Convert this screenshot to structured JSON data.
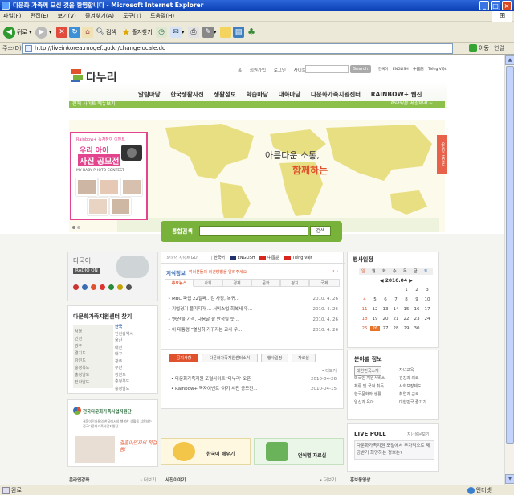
{
  "window": {
    "title": "다문화 가족께 오신 것을 환영합니다 - Microsoft Internet Explorer"
  },
  "menu": [
    "파일(F)",
    "편집(E)",
    "보기(V)",
    "즐겨찾기(A)",
    "도구(T)",
    "도움말(H)"
  ],
  "toolbar": {
    "back": "뒤로",
    "search": "검색",
    "favorites": "즐겨찾기"
  },
  "address": {
    "label": "주소(D)",
    "url": "http://liveinkorea.mogef.go.kr/changelocale.do",
    "go": "이동",
    "links": "연결"
  },
  "site": {
    "logo": "다누리",
    "top_links": [
      "홈",
      "회원가입",
      "로그인",
      "사이트맵"
    ],
    "search_button": "Search",
    "languages": [
      "한국어",
      "ENGLISH",
      "中國語",
      "Tiếng Việt"
    ],
    "shop_link": "전체 사이트 메뉴보기",
    "nav": [
      "알림마당",
      "한국생활사전",
      "생활정보",
      "학습마당",
      "대화마당",
      "다문화가족지원센터",
      "RAINBOW+ 웹진"
    ],
    "slogan": "하나되는 세상에서 ~",
    "quick_menu": "QUICK MENU"
  },
  "hero": {
    "line1": "아름다운 소통,",
    "line2": "함께하는"
  },
  "promo": {
    "top": "Rainbow+ 독자참여 이벤트",
    "line1": "우리 아이",
    "line2": "사진 공모전",
    "sub": "MY BABY PHOTO CONTEST"
  },
  "search": {
    "label": "통합검색",
    "button": "검색"
  },
  "radio": {
    "title": "다국어",
    "badge": "RADIO ON"
  },
  "center": {
    "title": "다문화가족지원센터 찾기",
    "regions": [
      "한국",
      "인천광역시",
      "울산",
      "대전",
      "대구",
      "광주",
      "부산",
      "강원도",
      "충청북도",
      "충청남도",
      "전라북도",
      "경상북도",
      "경상남도",
      "제주도"
    ],
    "regions_left": [
      "서울",
      "인천",
      "광주",
      "경기도",
      "강원도",
      "충청북도",
      "충청남도",
      "전라남도"
    ]
  },
  "notice": {
    "lang_title": "외국어 사이트 GO",
    "lang_items": [
      "한국어",
      "ENGLISH",
      "中國語",
      "Tiếng Việt"
    ],
    "knowledge_title": "지식정보",
    "knowledge_sub": "여러분들의 의견방법을 알려주세요",
    "tabs": [
      "주요뉴스",
      "사회",
      "경제",
      "문화",
      "정치",
      "국제"
    ],
    "items": [
      {
        "title": "MBC 파업 22일째...김 사장, 복귀...",
        "date": "2010. 4. 26"
      },
      {
        "title": "기업경기 불기지가 ... 서비스업 회복세 뚜...",
        "date": "2010. 4. 26"
      },
      {
        "title": "'농산물 가격, 다음달 할 안정될 듯...",
        "date": "2010. 4. 26"
      },
      {
        "title": "이 대통령 \"열심히 가꾸지는 교사 우...",
        "date": "2010. 4. 26"
      }
    ]
  },
  "calendar": {
    "title": "행사일정",
    "weekdays": [
      "일",
      "월",
      "화",
      "수",
      "목",
      "금",
      "토"
    ],
    "month": "◀ 2010.04 ▶",
    "rows": [
      [
        "",
        "",
        "",
        "",
        "1",
        "2",
        "3"
      ],
      [
        "4",
        "5",
        "6",
        "7",
        "8",
        "9",
        "10"
      ],
      [
        "11",
        "12",
        "13",
        "14",
        "15",
        "16",
        "17"
      ],
      [
        "18",
        "19",
        "20",
        "21",
        "22",
        "23",
        "24"
      ],
      [
        "25",
        "26",
        "27",
        "28",
        "29",
        "30",
        ""
      ]
    ],
    "today": "26"
  },
  "field": {
    "title": "분야별 정보",
    "rows": [
      [
        "대한민국소개",
        "자녀교육"
      ],
      [
        "외국인 지원서비스",
        "건강과 의료"
      ],
      [
        "체류 및 국적 취득",
        "사회보장제도"
      ],
      [
        "한국문화와 생활",
        "취업과 근로"
      ],
      [
        "임신과 육아",
        "대한민국 즐기기"
      ]
    ]
  },
  "poll": {
    "title": "LIVE POLL",
    "more": "지난설문보기",
    "question": "다문화가족지원 포털에서 추가적으로 제공받기 희망하는 정보는?"
  },
  "notice2": {
    "tabs": [
      "공지사항",
      "다문화가족지원센터소식",
      "행사일정",
      "자료실"
    ],
    "more": "• 더보기",
    "items": [
      {
        "title": "다문화가족지원 포털사이트 '다누리' 오픈",
        "date": "2010-04-26"
      },
      {
        "title": "Rainbow+ 독자이벤트 '아기 사진 공모전...",
        "date": "2010-04-15"
      }
    ]
  },
  "support": {
    "title": "전국다문화가족사업지원단",
    "sub": "결혼이민자들의 한국에서의 행복한 생활을 지원하는 전국다문화가족사업지원단",
    "hand": "결혼이민자의 첫걸음!"
  },
  "banners": {
    "korean": "한국어 배우기",
    "multi": "언어별 자료실"
  },
  "bottom": {
    "left": "온라인강좌",
    "left_more": "• 더보기",
    "mid": "사진이야기",
    "mid_more": "• 더보기",
    "right": "홍보동영상"
  },
  "status": {
    "text": "완료",
    "zone": "인터넷"
  }
}
